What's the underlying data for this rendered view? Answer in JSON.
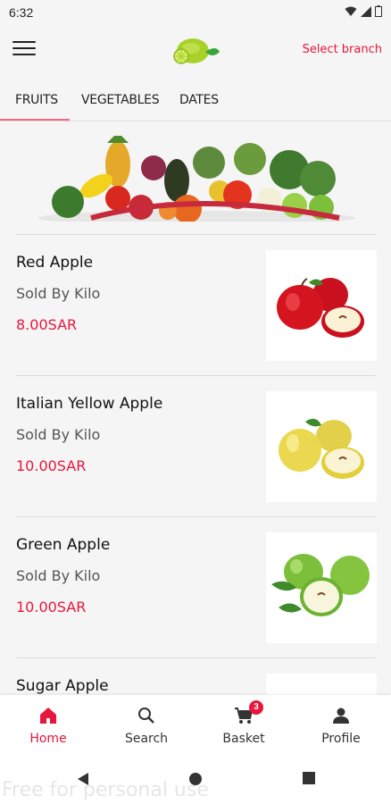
{
  "status_bar": {
    "time": "6:32"
  },
  "header": {
    "select_branch": "Select branch"
  },
  "tabs": [
    {
      "label": "FRUITS",
      "active": true
    },
    {
      "label": "VEGETABLES",
      "active": false
    },
    {
      "label": "DATES",
      "active": false
    }
  ],
  "products": [
    {
      "name": "Red Apple",
      "unit": "Sold By Kilo",
      "price": "8.00SAR",
      "image": "red-apple"
    },
    {
      "name": "Italian Yellow Apple",
      "unit": "Sold By Kilo",
      "price": "10.00SAR",
      "image": "yellow-apple"
    },
    {
      "name": "Green Apple",
      "unit": "Sold By Kilo",
      "price": "10.00SAR",
      "image": "green-apple"
    },
    {
      "name": "Sugar Apple",
      "unit": "",
      "price": "",
      "image": "sugar-apple"
    }
  ],
  "bottom_nav": {
    "home": "Home",
    "search": "Search",
    "basket": "Basket",
    "basket_count": "3",
    "profile": "Profile"
  },
  "watermark": "Free for personal use",
  "colors": {
    "accent": "#e8163c",
    "tab_indicator": "#f06b7e"
  }
}
